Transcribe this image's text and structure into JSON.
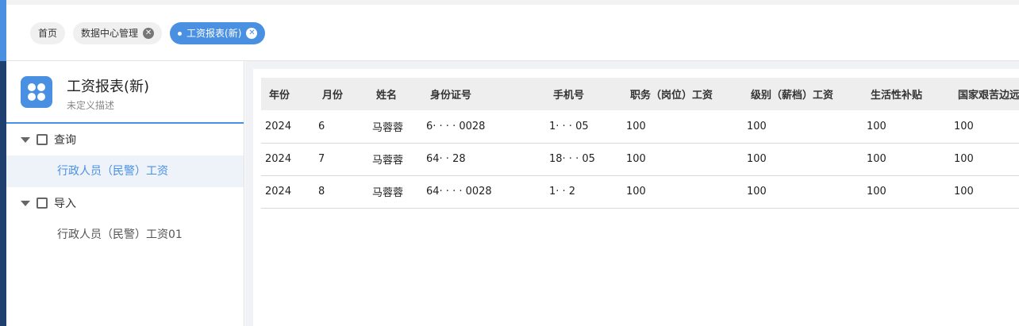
{
  "tabs": [
    {
      "label": "首页",
      "closable": false,
      "active": false
    },
    {
      "label": "数据中心管理",
      "closable": true,
      "active": false
    },
    {
      "label": "工资报表(新)",
      "closable": true,
      "active": true
    }
  ],
  "sidebar": {
    "title": "工资报表(新)",
    "subtitle": "未定义描述",
    "groups": [
      {
        "label": "查询",
        "icon": "query-icon",
        "items": [
          "行政人员（民警）工资"
        ]
      },
      {
        "label": "导入",
        "icon": "import-icon",
        "items": [
          "行政人员（民警）工资01"
        ]
      }
    ]
  },
  "table": {
    "columns": [
      "年份",
      "月份",
      "姓名",
      "身份证号",
      "手机号",
      "职务（岗位）工资",
      "级别（薪档）工资",
      "生活性补贴",
      "国家艰苦边远"
    ],
    "rows": [
      {
        "year": "2024",
        "month": "6",
        "name": "马蓉蓉",
        "id_number": "6·  ·  ·  ·  0028",
        "phone": "1·  ·  ·  05",
        "position_wage": "100",
        "level_wage": "100",
        "living_subsidy": "100",
        "remote_subsidy": "100"
      },
      {
        "year": "2024",
        "month": "7",
        "name": "马蓉蓉",
        "id_number": "64·  ·  28",
        "phone": "18·  ·  ·  05",
        "position_wage": "100",
        "level_wage": "100",
        "living_subsidy": "100",
        "remote_subsidy": "100"
      },
      {
        "year": "2024",
        "month": "8",
        "name": "马蓉蓉",
        "id_number": "64·  ·  ·  ·  0028",
        "phone": "1·  ·  2",
        "position_wage": "100",
        "level_wage": "100",
        "living_subsidy": "100",
        "remote_subsidy": "100"
      }
    ]
  }
}
